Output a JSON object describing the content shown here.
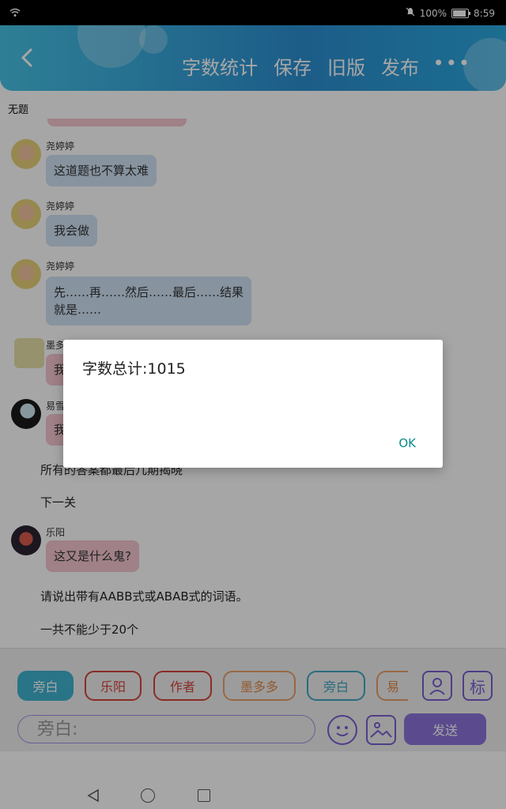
{
  "statusbar": {
    "battery": "100%",
    "time": "8:59"
  },
  "topbar": {
    "tabs": [
      "字数统计",
      "保存",
      "旧版",
      "发布"
    ],
    "more": "•••"
  },
  "subtitle": "无题",
  "messages": [
    {
      "name": "尧婷婷",
      "text": "这道题也不算太难"
    },
    {
      "name": "尧婷婷",
      "text": "我会做"
    },
    {
      "name": "尧婷婷",
      "text": "先……再……然后……最后……结果就是……"
    },
    {
      "name": "墨多",
      "text": "我"
    },
    {
      "name": "易雪",
      "text": "我"
    },
    {
      "name": "",
      "text": "所有的答案都最后几期揭晓"
    },
    {
      "name": "",
      "text": "下一关"
    },
    {
      "name": "乐阳",
      "text": "这又是什么鬼?"
    },
    {
      "name": "",
      "text": "请说出带有AABB式或ABAB式的词语。"
    },
    {
      "name": "",
      "text": "一共不能少于20个"
    }
  ],
  "dialog": {
    "title": "字数总计:1015",
    "ok": "OK"
  },
  "bottom": {
    "chips": [
      "旁白",
      "乐阳",
      "作者",
      "墨多多",
      "旁白",
      "易"
    ],
    "input_placeholder": "旁白:",
    "send_label": "发送",
    "icon_label": "标"
  },
  "colors": {
    "accent": "#2b8fd2",
    "send": "#8c73db",
    "ok": "#0a8a8a"
  }
}
